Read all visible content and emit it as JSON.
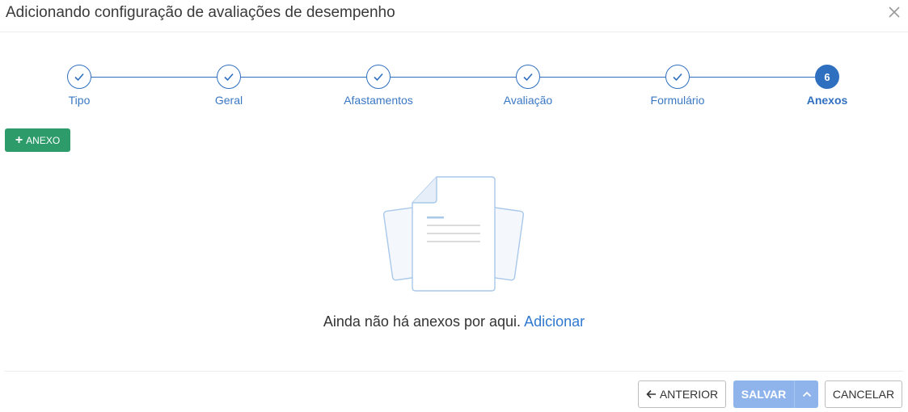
{
  "modal": {
    "title": "Adicionando configuração de avaliações de desempenho",
    "close_icon": "close-icon"
  },
  "stepper": {
    "steps": [
      {
        "label": "Tipo",
        "state": "done"
      },
      {
        "label": "Geral",
        "state": "done"
      },
      {
        "label": "Afastamentos",
        "state": "done"
      },
      {
        "label": "Avaliação",
        "state": "done"
      },
      {
        "label": "Formulário",
        "state": "done"
      },
      {
        "label": "Anexos",
        "state": "active",
        "number": "6"
      }
    ],
    "color": "#2f6fbf"
  },
  "toolbar": {
    "add_label": "ANEXO",
    "add_color": "#2e9b6b"
  },
  "empty_state": {
    "message": "Ainda não há anexos por aqui.",
    "link": "Adicionar",
    "illustration_icon": "document-stack-icon"
  },
  "footer": {
    "prev_label": "ANTERIOR",
    "save_label": "SALVAR",
    "cancel_label": "CANCELAR",
    "save_color": "#8fb4ec"
  }
}
